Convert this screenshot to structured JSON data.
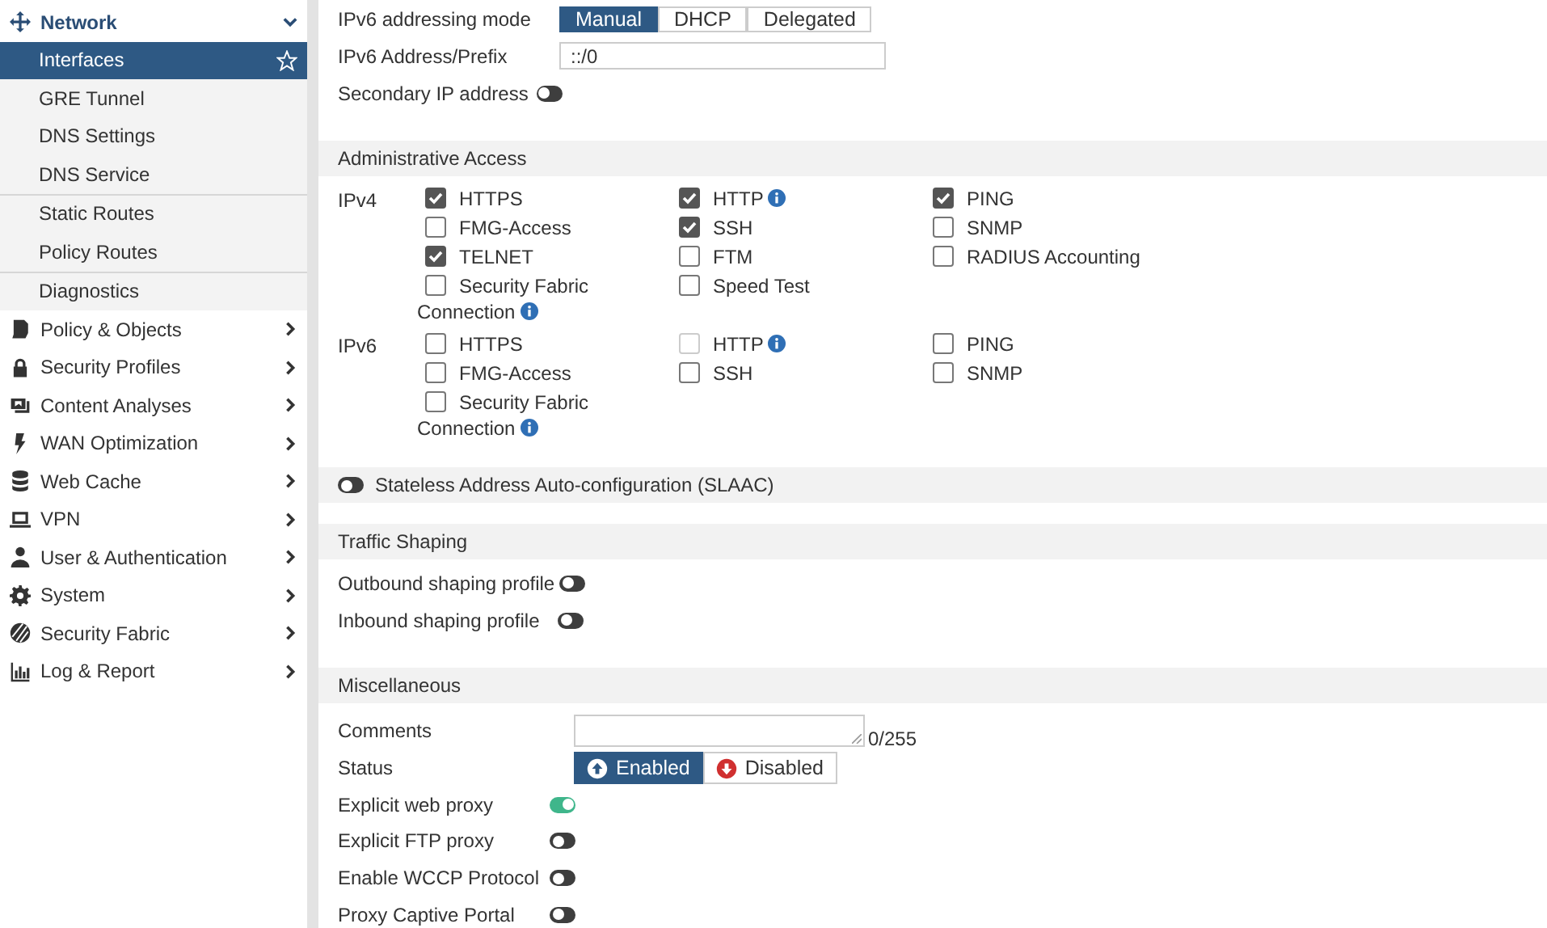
{
  "sidebar": {
    "items": [
      {
        "label": "Network",
        "expanded": true,
        "children": [
          [
            {
              "label": "Interfaces",
              "selected": true
            },
            {
              "label": "GRE Tunnel",
              "selected": false
            },
            {
              "label": "DNS Settings",
              "selected": false
            },
            {
              "label": "DNS Service",
              "selected": false
            }
          ],
          [
            {
              "label": "Static Routes",
              "selected": false
            },
            {
              "label": "Policy Routes",
              "selected": false
            }
          ],
          [
            {
              "label": "Diagnostics",
              "selected": false
            }
          ]
        ]
      },
      {
        "label": "Policy & Objects",
        "expanded": false
      },
      {
        "label": "Security Profiles",
        "expanded": false
      },
      {
        "label": "Content Analyses",
        "expanded": false
      },
      {
        "label": "WAN Optimization",
        "expanded": false
      },
      {
        "label": "Web Cache",
        "expanded": false
      },
      {
        "label": "VPN",
        "expanded": false
      },
      {
        "label": "User & Authentication",
        "expanded": false
      },
      {
        "label": "System",
        "expanded": false
      },
      {
        "label": "Security Fabric",
        "expanded": false
      },
      {
        "label": "Log & Report",
        "expanded": false
      }
    ]
  },
  "top_fields": [
    {
      "kind": "segmented",
      "label": "IPv6 addressing mode",
      "options": [
        {
          "label": "Manual",
          "selected": true
        },
        {
          "label": "DHCP",
          "selected": false
        },
        {
          "label": "Delegated",
          "selected": false
        }
      ]
    },
    {
      "kind": "text",
      "label": "IPv6 Address/Prefix",
      "value": "::/0"
    },
    {
      "kind": "toggle",
      "label": "Secondary IP address",
      "on": false
    }
  ],
  "administrative_access": {
    "title": "Administrative Access",
    "groups": [
      {
        "label": "IPv4",
        "options": [
          {
            "label": "HTTPS",
            "checked": true,
            "disabled": false,
            "info": false
          },
          {
            "label": "HTTP",
            "checked": true,
            "disabled": false,
            "info": true
          },
          {
            "label": "PING",
            "checked": true,
            "disabled": false,
            "info": false
          },
          {
            "label": "FMG-Access",
            "checked": false,
            "disabled": false,
            "info": false
          },
          {
            "label": "SSH",
            "checked": true,
            "disabled": false,
            "info": false
          },
          {
            "label": "SNMP",
            "checked": false,
            "disabled": false,
            "info": false
          },
          {
            "label": "TELNET",
            "checked": true,
            "disabled": false,
            "info": false
          },
          {
            "label": "FTM",
            "checked": false,
            "disabled": false,
            "info": false
          },
          {
            "label": "RADIUS Accounting",
            "checked": false,
            "disabled": false,
            "info": false
          },
          {
            "label": "Security Fabric Connection",
            "checked": false,
            "disabled": false,
            "info": true
          },
          {
            "label": "Speed Test",
            "checked": false,
            "disabled": false,
            "info": false
          }
        ]
      },
      {
        "label": "IPv6",
        "options": [
          {
            "label": "HTTPS",
            "checked": false,
            "disabled": false,
            "info": false
          },
          {
            "label": "HTTP",
            "checked": false,
            "disabled": true,
            "info": true
          },
          {
            "label": "PING",
            "checked": false,
            "disabled": false,
            "info": false
          },
          {
            "label": "FMG-Access",
            "checked": false,
            "disabled": false,
            "info": false
          },
          {
            "label": "SSH",
            "checked": false,
            "disabled": false,
            "info": false
          },
          {
            "label": "SNMP",
            "checked": false,
            "disabled": false,
            "info": false
          },
          {
            "label": "Security Fabric Connection",
            "checked": false,
            "disabled": false,
            "info": true
          }
        ]
      }
    ]
  },
  "slaac": {
    "label": "Stateless Address Auto-configuration (SLAAC)",
    "on": false
  },
  "traffic_shaping": {
    "title": "Traffic Shaping",
    "rows": [
      {
        "label": "Outbound shaping profile",
        "on": false
      },
      {
        "label": "Inbound shaping profile",
        "on": false
      }
    ]
  },
  "miscellaneous": {
    "title": "Miscellaneous",
    "comments": {
      "label": "Comments",
      "counter": "0/255"
    },
    "status": {
      "label": "Status",
      "options": [
        {
          "label": "Enabled",
          "kind": "up",
          "selected": true
        },
        {
          "label": "Disabled",
          "kind": "down",
          "selected": false
        }
      ]
    },
    "toggles": [
      {
        "label": "Explicit web proxy",
        "on": true
      },
      {
        "label": "Explicit FTP proxy",
        "on": false
      },
      {
        "label": "Enable WCCP Protocol",
        "on": false
      },
      {
        "label": "Proxy Captive Portal",
        "on": false
      }
    ]
  }
}
